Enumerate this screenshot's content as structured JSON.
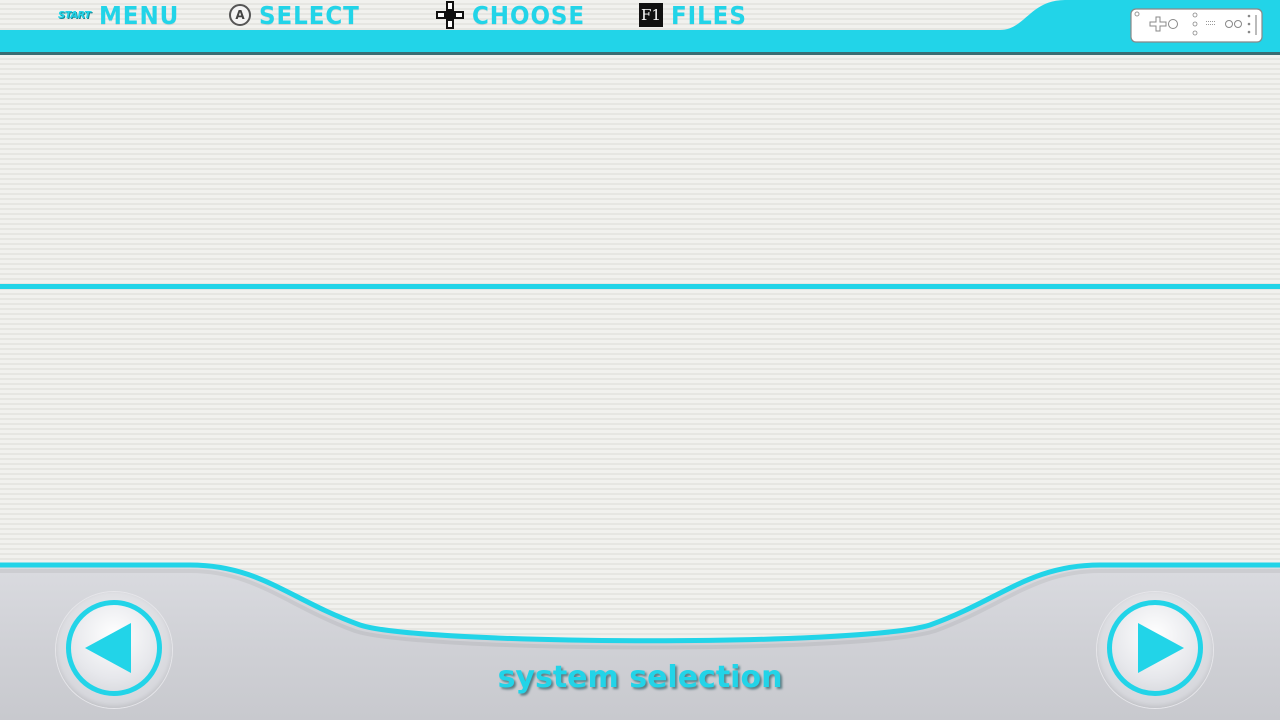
{
  "colors": {
    "accent": "#22d4e8",
    "background": "#eeeeea",
    "panel": "#d6d7dc"
  },
  "header": {
    "hints": [
      {
        "icon": "start-button-icon",
        "icon_text": "START",
        "label": "MENU"
      },
      {
        "icon": "a-button-icon",
        "icon_text": "A",
        "label": "SELECT"
      },
      {
        "icon": "dpad-icon",
        "label": "CHOOSE"
      },
      {
        "icon": "f1-key-icon",
        "icon_text": "F1",
        "label": "FILES"
      }
    ],
    "controller_icon": "wii-remote-icon"
  },
  "nav": {
    "prev_icon": "left-arrow-icon",
    "next_icon": "right-arrow-icon"
  },
  "footer": {
    "title": "system selection"
  }
}
